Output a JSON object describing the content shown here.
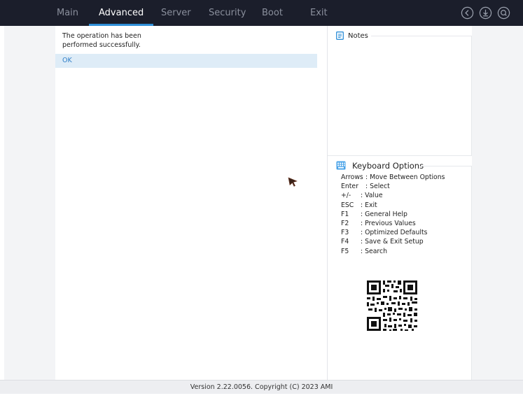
{
  "menu": {
    "tabs": [
      {
        "label": "Main"
      },
      {
        "label": "Advanced"
      },
      {
        "label": "Server"
      },
      {
        "label": "Security"
      },
      {
        "label": "Boot"
      },
      {
        "label": "Exit"
      }
    ],
    "active_tab": "Advanced",
    "icons": [
      "back-icon",
      "download-icon",
      "search-icon"
    ]
  },
  "dialog": {
    "message_line1": "The operation has been",
    "message_line2": "performed successfully.",
    "ok_label": "OK"
  },
  "notes": {
    "title": "Notes",
    "icon": "notes-icon"
  },
  "keyboard": {
    "title": "Keyboard Options",
    "icon": "keyboard-icon",
    "items": [
      {
        "key": "Arrows",
        "desc": ": Move Between Options"
      },
      {
        "key": "Enter",
        "desc": ": Select"
      },
      {
        "key": "+/-",
        "desc": ": Value"
      },
      {
        "key": "ESC",
        "desc": ": Exit"
      },
      {
        "key": "F1",
        "desc": ": General Help"
      },
      {
        "key": "F2",
        "desc": ": Previous Values"
      },
      {
        "key": "F3",
        "desc": ": Optimized Defaults"
      },
      {
        "key": "F4",
        "desc": ": Save & Exit Setup"
      },
      {
        "key": "F5",
        "desc": ": Search"
      }
    ]
  },
  "footer": {
    "version": "Version 2.22.0056. Copyright (C) 2023 AMI"
  },
  "colors": {
    "topbar": "#1b1e2b",
    "accent": "#2f8fd8",
    "selection": "#deecf7",
    "ok_text": "#2f7fc8"
  }
}
